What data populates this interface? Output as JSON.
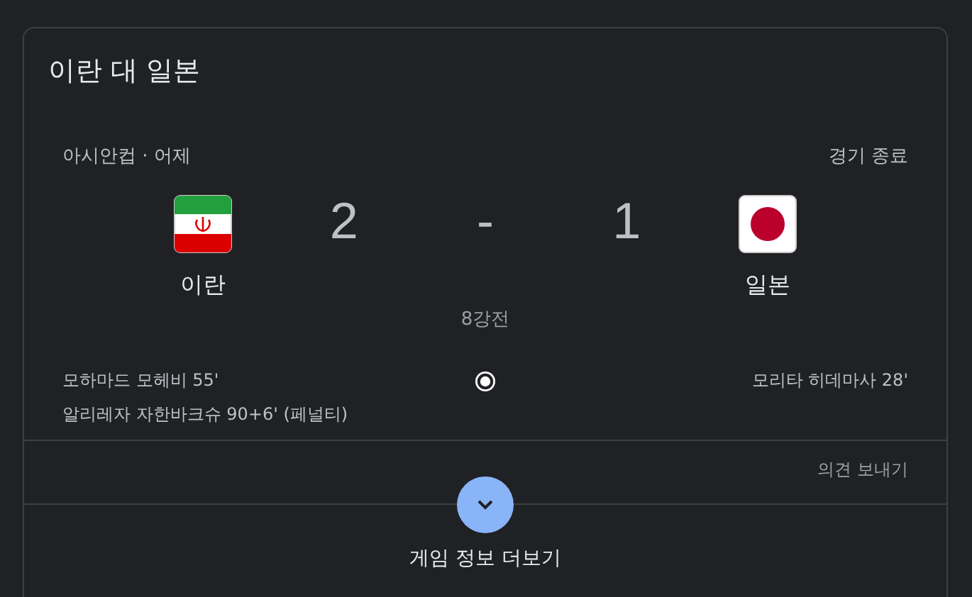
{
  "title": "이란 대 일본",
  "meta": {
    "competition": "아시안컵",
    "dot": "·",
    "date": "어제",
    "status": "경기 종료"
  },
  "home": {
    "name": "이란",
    "score": "2",
    "kind": "iran",
    "goals": [
      "모하마드 모헤비 55'",
      "알리레자 자한바크슈 90+6' (페널티)"
    ]
  },
  "separator": "-",
  "away": {
    "name": "일본",
    "score": "1",
    "kind": "japan",
    "goals": [
      "모리타 히데마사 28'"
    ]
  },
  "round": "8강전",
  "feedback": "의견 보내기",
  "more": "게임 정보 더보기"
}
